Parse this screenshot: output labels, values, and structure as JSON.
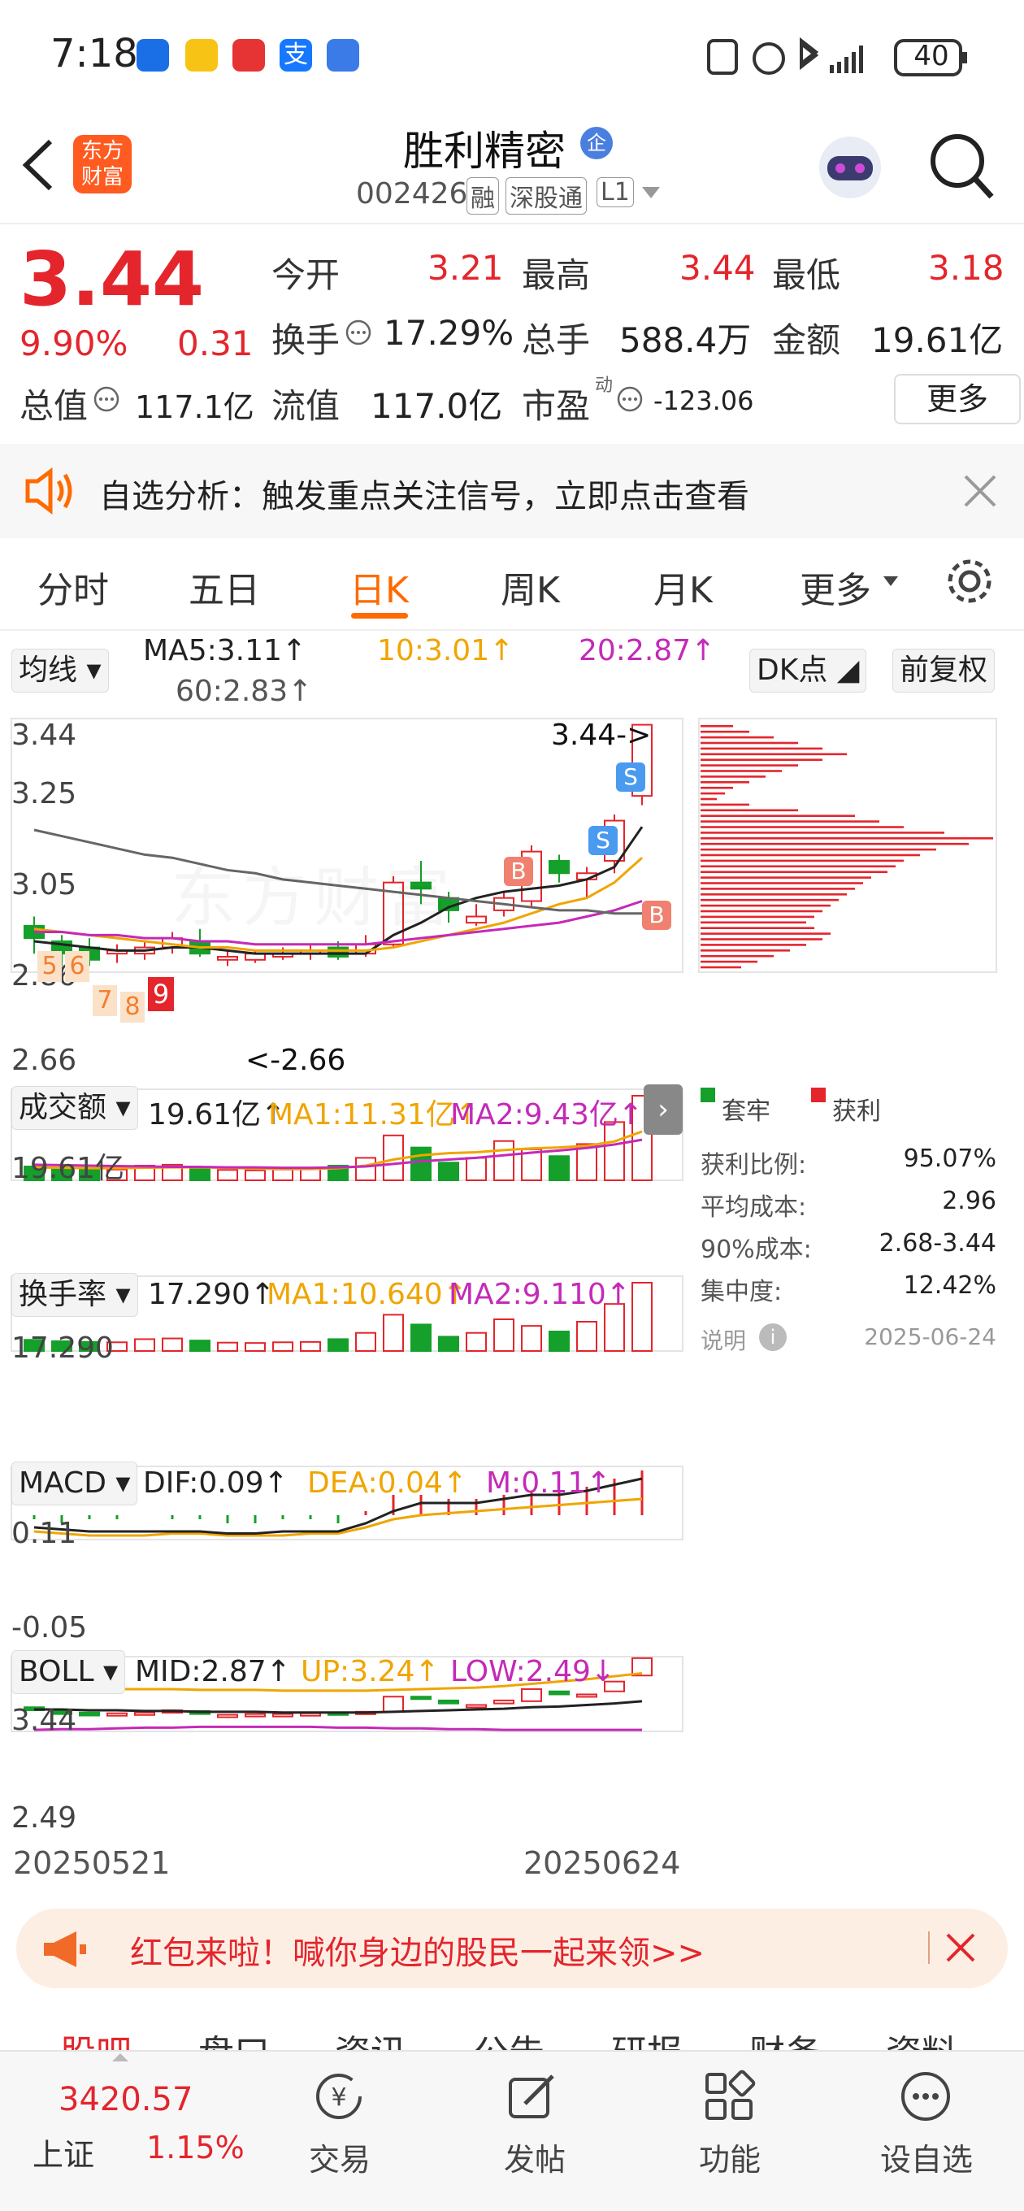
{
  "status_bar": {
    "time": "7:18",
    "battery": "40"
  },
  "header": {
    "title": "胜利精密",
    "badge": "企",
    "code": "002426",
    "tags": [
      "融",
      "深股通",
      "L1"
    ],
    "logo_line1": "东方",
    "logo_line2": "财富"
  },
  "quote": {
    "price": "3.44",
    "change_pct": "9.90%",
    "change": "0.31",
    "stats": [
      {
        "label": "今开",
        "value": "3.21",
        "color": "red"
      },
      {
        "label": "最高",
        "value": "3.44",
        "color": "red"
      },
      {
        "label": "最低",
        "value": "3.18",
        "color": "red"
      },
      {
        "label": "换手",
        "value": "17.29%",
        "color": "dark"
      },
      {
        "label": "总手",
        "value": "588.4万",
        "color": "dark"
      },
      {
        "label": "金额",
        "value": "19.61亿",
        "color": "dark"
      },
      {
        "label": "总值",
        "value": "117.1亿",
        "color": "dark"
      },
      {
        "label": "流值",
        "value": "117.0亿",
        "color": "dark"
      },
      {
        "label": "市盈",
        "value": "-123.06",
        "color": "dark"
      }
    ],
    "pe_sup": "动",
    "more": "更多"
  },
  "banner": {
    "text": "自选分析：触发重点关注信号，立即点击查看"
  },
  "tabs": [
    "分时",
    "五日",
    "日K",
    "周K",
    "月K",
    "更多"
  ],
  "kline": {
    "ma_select": "均线",
    "ma5": "MA5:3.11↑",
    "ma10": "10:3.01↑",
    "ma20": "20:2.87↑",
    "ma60": "60:2.83↑",
    "dk_btn": "DK点",
    "fq_btn": "前复权",
    "y_labels": [
      "3.44",
      "3.25",
      "3.05",
      "2.86",
      "2.66"
    ],
    "high_annot": "3.44->",
    "low_annot": "<-2.66",
    "watermark": "东方财富",
    "count_marks": [
      "5",
      "6",
      "7",
      "8",
      "9"
    ],
    "buy_mark": "B",
    "sell_mark": "S"
  },
  "volume": {
    "select": "成交额",
    "value": "19.61亿↑",
    "ma1": "MA1:11.31亿↑",
    "ma2": "MA2:9.43亿↑",
    "max": "19.61亿"
  },
  "turnover": {
    "select": "换手率",
    "value": "17.290↑",
    "ma1": "MA1:10.640↑",
    "ma2": "MA2:9.110↑",
    "max": "17.290"
  },
  "macd": {
    "select": "MACD",
    "dif": "DIF:0.09↑",
    "dea": "DEA:0.04↑",
    "m": "M:0.11↑",
    "max": "0.11",
    "min": "-0.05"
  },
  "boll": {
    "select": "BOLL",
    "mid": "MID:2.87↑",
    "up": "UP:3.24↑",
    "low": "LOW:2.49↓",
    "max": "3.44",
    "min": "2.49"
  },
  "dates": {
    "start": "20250521",
    "end": "20250624"
  },
  "chip": {
    "legend_trapped": "套牢",
    "legend_profit": "获利",
    "rows": [
      {
        "label": "获利比例:",
        "value": "95.07%"
      },
      {
        "label": "平均成本:",
        "value": "2.96"
      },
      {
        "label": "90%成本:",
        "value": "2.68-3.44"
      },
      {
        "label": "集中度:",
        "value": "12.42%"
      }
    ],
    "note": "说明",
    "date": "2025-06-24"
  },
  "promo": {
    "text": "红包来啦！喊你身边的股民一起来领>>"
  },
  "sub_tabs": [
    "股吧",
    "盘口",
    "资讯",
    "公告",
    "研报",
    "财务",
    "资料"
  ],
  "bottom": {
    "index_value": "3420.57",
    "index_name": "上证",
    "index_pct": "1.15%",
    "items": [
      "交易",
      "发帖",
      "功能",
      "设自选"
    ]
  },
  "colors": {
    "up": "#e4252c",
    "down": "#14a02a",
    "ma_orange": "#f0a500",
    "ma_purple": "#c42ab8",
    "accent": "#ff6a00"
  }
}
